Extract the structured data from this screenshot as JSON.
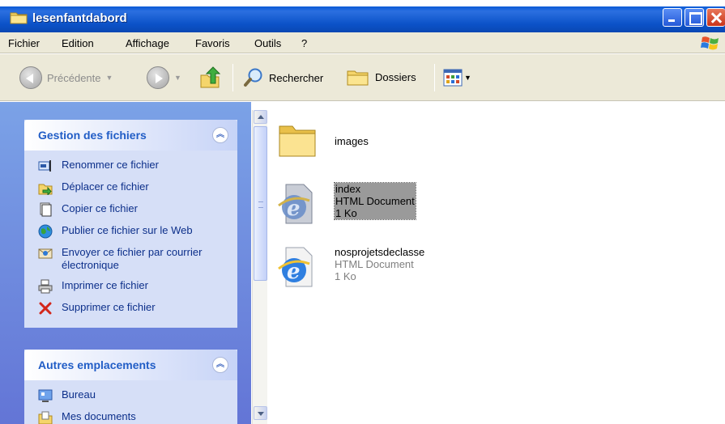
{
  "window": {
    "title": "lesenfantdabord"
  },
  "menu": {
    "items": [
      "Fichier",
      "Edition",
      "Affichage",
      "Favoris",
      "Outils",
      "?"
    ]
  },
  "toolbar": {
    "back_label": "Précédente",
    "search_label": "Rechercher",
    "folders_label": "Dossiers"
  },
  "taskpane": {
    "file_tasks": {
      "title": "Gestion des fichiers",
      "items": [
        {
          "label": "Renommer ce fichier",
          "icon": "rename-icon"
        },
        {
          "label": "Déplacer ce fichier",
          "icon": "move-icon"
        },
        {
          "label": "Copier ce fichier",
          "icon": "copy-icon"
        },
        {
          "label": "Publier ce fichier sur le Web",
          "icon": "publish-web-icon"
        },
        {
          "label": "Envoyer ce fichier par courrier électronique",
          "icon": "email-icon"
        },
        {
          "label": "Imprimer ce fichier",
          "icon": "print-icon"
        },
        {
          "label": "Supprimer ce fichier",
          "icon": "delete-icon"
        }
      ]
    },
    "other_places": {
      "title": "Autres emplacements",
      "items": [
        {
          "label": "Bureau",
          "icon": "desktop-icon"
        },
        {
          "label": "Mes documents",
          "icon": "my-documents-icon"
        }
      ]
    }
  },
  "files": [
    {
      "name": "images",
      "type": "",
      "size": "",
      "icon": "folder-icon",
      "selected": false
    },
    {
      "name": "index",
      "type": "HTML Document",
      "size": "1 Ko",
      "icon": "ie-document-icon",
      "selected": true
    },
    {
      "name": "nosprojetsdeclasse",
      "type": "HTML Document",
      "size": "1 Ko",
      "icon": "ie-document-icon",
      "selected": false
    }
  ],
  "colors": {
    "titlebar": "#0b52c8",
    "taskpane_bg": "#6f8edf",
    "panel_title": "#215dc6",
    "task_link": "#0c2f8a",
    "selection": "#9a9a9a"
  }
}
